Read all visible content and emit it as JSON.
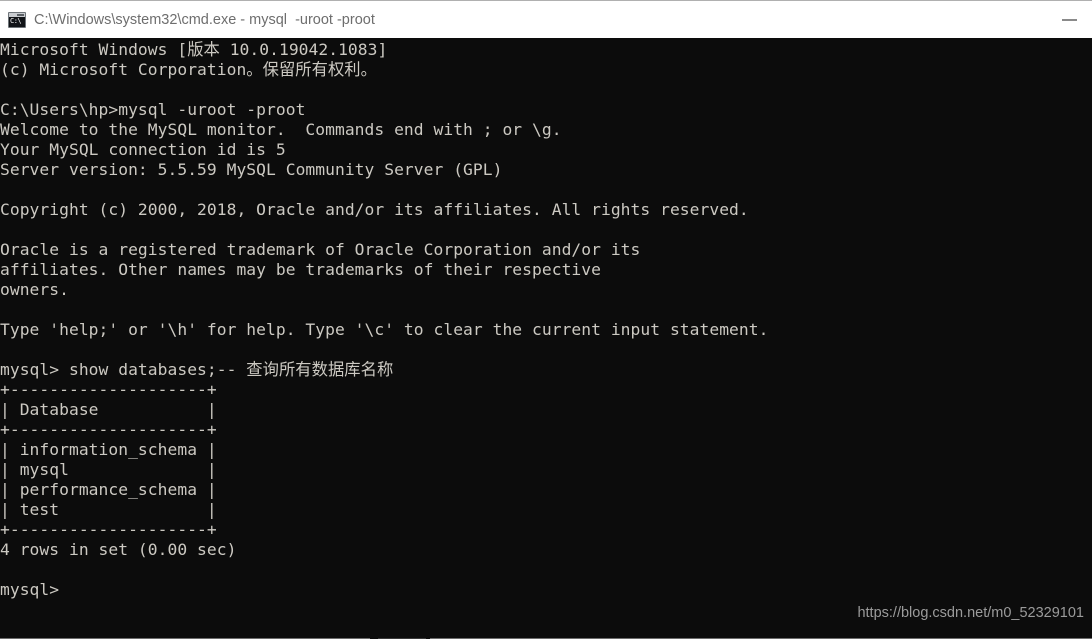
{
  "window": {
    "title": "C:\\Windows\\system32\\cmd.exe - mysql  -uroot -proot",
    "icon_name": "cmd-console-icon",
    "icon_text": "C:\\",
    "controls": {
      "minimize_label": "—"
    },
    "colors": {
      "titlebar_bg": "#ffffff",
      "titlebar_text": "#6e6e6e",
      "console_bg": "#0c0c0c",
      "console_text": "#ccc9c2",
      "watermark_text": "#9b9b9b"
    }
  },
  "console": {
    "lines": [
      "Microsoft Windows [版本 10.0.19042.1083]",
      "(c) Microsoft Corporation。保留所有权利。",
      "",
      "C:\\Users\\hp>mysql -uroot -proot",
      "Welcome to the MySQL monitor.  Commands end with ; or \\g.",
      "Your MySQL connection id is 5",
      "Server version: 5.5.59 MySQL Community Server (GPL)",
      "",
      "Copyright (c) 2000, 2018, Oracle and/or its affiliates. All rights reserved.",
      "",
      "Oracle is a registered trademark of Oracle Corporation and/or its",
      "affiliates. Other names may be trademarks of their respective",
      "owners.",
      "",
      "Type 'help;' or '\\h' for help. Type '\\c' to clear the current input statement.",
      "",
      "mysql> show databases;-- 查询所有数据库名称",
      "+--------------------+",
      "| Database           |",
      "+--------------------+",
      "| information_schema |",
      "| mysql              |",
      "| performance_schema |",
      "| test               |",
      "+--------------------+",
      "4 rows in set (0.00 sec)",
      "",
      "mysql>"
    ],
    "command": "show databases;-- 查询所有数据库名称",
    "prompt": "mysql>",
    "result_table": {
      "columns": [
        "Database"
      ],
      "rows": [
        [
          "information_schema"
        ],
        [
          "mysql"
        ],
        [
          "performance_schema"
        ],
        [
          "test"
        ]
      ],
      "footer": "4 rows in set (0.00 sec)"
    }
  },
  "watermark": {
    "text": "https://blog.csdn.net/m0_52329101"
  }
}
